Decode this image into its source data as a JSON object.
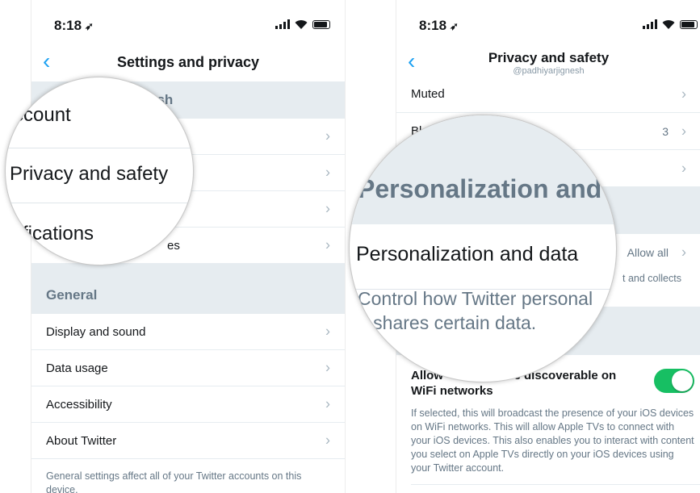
{
  "left": {
    "status": {
      "time": "8:18"
    },
    "nav": {
      "title": "Settings and privacy"
    },
    "account_section": {
      "header": "esh"
    },
    "account_rows": [
      {
        "label": ""
      },
      {
        "label": ""
      },
      {
        "label": ""
      },
      {
        "label": "es"
      }
    ],
    "general": {
      "header": "General",
      "rows": [
        {
          "label": "Display and sound"
        },
        {
          "label": "Data usage"
        },
        {
          "label": "Accessibility"
        },
        {
          "label": "About Twitter"
        }
      ],
      "footnote": "General settings affect all of your Twitter accounts on this device."
    },
    "magnifier": {
      "account": "ccount",
      "privacy": "Privacy and safety",
      "notifications": "tifications"
    }
  },
  "right": {
    "status": {
      "time": "8:18"
    },
    "nav": {
      "title": "Privacy and safety",
      "subtitle": "@padhiyarjignesh"
    },
    "rows": {
      "muted": "Muted",
      "blocked": "Bl",
      "blocked_count": "3"
    },
    "personalization": {
      "value": "Allow all",
      "desc_fragment": "t and collects"
    },
    "discoverable": {
      "label_start": "Allow",
      "label_end": "be discoverable on",
      "label_line2": "WiFi networks",
      "description": "If selected, this will broadcast the presence of your iOS devices on WiFi networks. This will allow Apple TVs to connect with your iOS devices. This also enables you to interact with content you select on Apple TVs directly on your iOS devices using your Twitter account."
    },
    "magnifier": {
      "section_header": "Personalization and",
      "row_label": "Personalization and data",
      "desc_line1": "Control how Twitter personal",
      "desc_line2": "d shares certain data."
    }
  },
  "colors": {
    "accent": "#1da1f2",
    "section_bg": "#e6ecf0",
    "secondary_text": "#657786",
    "toggle_on": "#17bf63"
  }
}
